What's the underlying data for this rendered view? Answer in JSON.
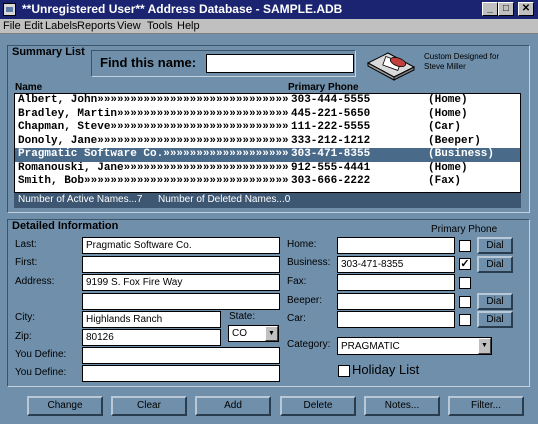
{
  "window": {
    "title": "**Unregistered User** Address Database - SAMPLE.ADB",
    "minimize": "_",
    "maximize": "□",
    "close": "✕"
  },
  "menu": [
    "File",
    "Edit",
    "Labels",
    "Reports",
    "View",
    "Tools",
    "Help"
  ],
  "summary": {
    "title": "Summary List",
    "find_label": "Find this name:",
    "find_value": "",
    "custom_line1": "Custom Designed for",
    "custom_line2": "Steve Miller",
    "header_name": "Name",
    "header_phone": "Primary Phone",
    "rows": [
      {
        "name": "Albert, John»»»»»»»»»»»»»»»»»»»»»»»»»»»»»»»»»»»»»»",
        "phone": "303-444-5555",
        "type": "(Home)"
      },
      {
        "name": "Bradley, Martin»»»»»»»»»»»»»»»»»»»»»»»»»»»»»»»»»»»",
        "phone": "445-221-5650",
        "type": "(Home)"
      },
      {
        "name": "Chapman, Steve»»»»»»»»»»»»»»»»»»»»»»»»»»»»»»»»»»»»",
        "phone": "111-222-5555",
        "type": "(Car)"
      },
      {
        "name": "Donoly, Jane»»»»»»»»»»»»»»»»»»»»»»»»»»»»»»»»»»»»»»",
        "phone": "333-212-1212",
        "type": "(Beeper)"
      },
      {
        "name": "Pragmatic Software Co.»»»»»»»»»»»»»»»»»»»»»»»»»»»»",
        "phone": "303-471-8355",
        "type": "(Business)"
      },
      {
        "name": "Romanouski, Jane»»»»»»»»»»»»»»»»»»»»»»»»»»»»»»»»»»",
        "phone": "912-555-4441",
        "type": "(Home)"
      },
      {
        "name": "Smith, Bob»»»»»»»»»»»»»»»»»»»»»»»»»»»»»»»»»»»»»»»»",
        "phone": "303-666-2222",
        "type": "(Fax)"
      }
    ],
    "selected_index": 4,
    "active_names": "Number of Active Names...7",
    "deleted_names": "Number of Deleted Names...0"
  },
  "detail": {
    "title": "Detailed Information",
    "primary_phone_label": "Primary Phone",
    "last_label": "Last:",
    "last_value": "Pragmatic Software Co.",
    "first_label": "First:",
    "first_value": "",
    "address_label": "Address:",
    "address1_value": "9199 S. Fox Fire Way",
    "address2_value": "",
    "city_label": "City:",
    "city_value": "Highlands Ranch",
    "state_label": "State:",
    "state_value": "CO",
    "zip_label": "Zip:",
    "zip_value": "80126",
    "you_define1_label": "You Define:",
    "you_define1_value": "",
    "you_define2_label": "You Define:",
    "you_define2_value": "",
    "home_label": "Home:",
    "home_value": "",
    "business_label": "Business:",
    "business_value": "303-471-8355",
    "fax_label": "Fax:",
    "fax_value": "",
    "beeper_label": "Beeper:",
    "beeper_value": "",
    "car_label": "Car:",
    "car_value": "",
    "dial_label": "Dial",
    "check_mark": "✓",
    "category_label": "Category:",
    "category_value": "PRAGMATIC",
    "holiday_label": "Holiday List"
  },
  "buttons": [
    "Change",
    "Clear",
    "Add",
    "Delete",
    "Notes...",
    "Filter..."
  ]
}
